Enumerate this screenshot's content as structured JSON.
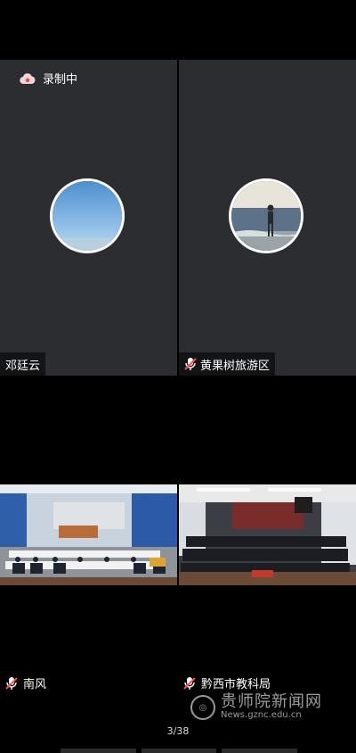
{
  "recording": {
    "label": "录制中",
    "icon": "cloud-record-icon"
  },
  "participants": [
    {
      "name": "邓廷云",
      "muted": false,
      "view": "avatar"
    },
    {
      "name": "黄果树旅游区",
      "muted": true,
      "view": "avatar"
    },
    {
      "name": "南风",
      "muted": true,
      "view": "video"
    },
    {
      "name": "黔西市教科局",
      "muted": true,
      "view": "video"
    }
  ],
  "page_indicator": "3/38",
  "watermark": {
    "title": "贵师院新闻网",
    "url": "News.gznc.edu.cn"
  },
  "colors": {
    "tile_bg": "#2b2d31",
    "mic_muted": "#ff4d4f",
    "record": "#f6d5d5"
  }
}
